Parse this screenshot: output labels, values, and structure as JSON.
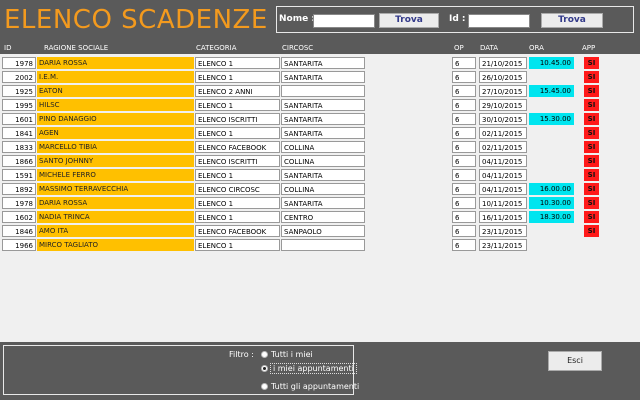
{
  "header": {
    "title": "ELENCO SCADENZE"
  },
  "search": {
    "nome_label": "Nome :",
    "nome_value": "",
    "trova1": "Trova",
    "id_label": "Id :",
    "id_value": "",
    "trova2": "Trova"
  },
  "columns": [
    "ID",
    "RAGIONE SOCIALE",
    "CATEGORIA",
    "CIRCOSC",
    "OP",
    "DATA",
    "ORA",
    "APP"
  ],
  "rows": [
    {
      "id": "1978",
      "rag": "DARIA ROSSA",
      "cat": "ELENCO 1",
      "cir": "SANTARITA",
      "op": "6",
      "data": "21/10/2015",
      "ora": "10.45.00",
      "app": "SI"
    },
    {
      "id": "2002",
      "rag": "I.E.M.",
      "cat": "ELENCO 1",
      "cir": "SANTARITA",
      "op": "6",
      "data": "26/10/2015",
      "ora": "",
      "app": "SI"
    },
    {
      "id": "1925",
      "rag": "EATON",
      "cat": "ELENCO 2 ANNI",
      "cir": "",
      "op": "6",
      "data": "27/10/2015",
      "ora": "15.45.00",
      "app": "SI"
    },
    {
      "id": "1995",
      "rag": "HILSC",
      "cat": "ELENCO 1",
      "cir": "SANTARITA",
      "op": "6",
      "data": "29/10/2015",
      "ora": "",
      "app": "SI"
    },
    {
      "id": "1601",
      "rag": "PINO DANAGGIO",
      "cat": "ELENCO ISCRITTI",
      "cir": "SANTARITA",
      "op": "6",
      "data": "30/10/2015",
      "ora": "15.30.00",
      "app": "SI"
    },
    {
      "id": "1841",
      "rag": "AGEN",
      "cat": "ELENCO 1",
      "cir": "SANTARITA",
      "op": "6",
      "data": "02/11/2015",
      "ora": "",
      "app": "SI"
    },
    {
      "id": "1833",
      "rag": "MARCELLO TIBIA",
      "cat": "ELENCO FACEBOOK",
      "cir": "COLLINA",
      "op": "6",
      "data": "02/11/2015",
      "ora": "",
      "app": "SI"
    },
    {
      "id": "1866",
      "rag": "SANTO JOHNNY",
      "cat": "ELENCO ISCRITTI",
      "cir": "COLLINA",
      "op": "6",
      "data": "04/11/2015",
      "ora": "",
      "app": "SI"
    },
    {
      "id": "1591",
      "rag": "MICHELE FERRO",
      "cat": "ELENCO 1",
      "cir": "SANTARITA",
      "op": "6",
      "data": "04/11/2015",
      "ora": "",
      "app": "SI"
    },
    {
      "id": "1892",
      "rag": "MASSIMO TERRAVECCHIA",
      "cat": "ELENCO CIRCOSC",
      "cir": "COLLINA",
      "op": "6",
      "data": "04/11/2015",
      "ora": "16.00.00",
      "app": "SI"
    },
    {
      "id": "1978",
      "rag": "DARIA ROSSA",
      "cat": "ELENCO 1",
      "cir": "SANTARITA",
      "op": "6",
      "data": "10/11/2015",
      "ora": "10.30.00",
      "app": "SI"
    },
    {
      "id": "1602",
      "rag": "NADIA TRINCA",
      "cat": "ELENCO 1",
      "cir": "CENTRO",
      "op": "6",
      "data": "16/11/2015",
      "ora": "18.30.00",
      "app": "SI"
    },
    {
      "id": "1846",
      "rag": "AMO ITA",
      "cat": "ELENCO FACEBOOK",
      "cir": "SANPAOLO",
      "op": "6",
      "data": "23/11/2015",
      "ora": "",
      "app": "SI"
    },
    {
      "id": "1966",
      "rag": "MIRCO TAGLIATO",
      "cat": "ELENCO 1",
      "cir": "",
      "op": "6",
      "data": "23/11/2015",
      "ora": "",
      "app": ""
    }
  ],
  "filter": {
    "label": "Filtro :",
    "options": [
      "Tutti i miei",
      "i miei appuntamenti",
      "Tutti gli appuntamenti"
    ],
    "selected": 1
  },
  "esci": "Esci",
  "colors": {
    "accent": "#f39a1e",
    "rag_bg": "#ffc000",
    "ora_bg": "#00e5ef",
    "app_bg": "#ff1a1a",
    "bg": "#5a5a5a"
  }
}
